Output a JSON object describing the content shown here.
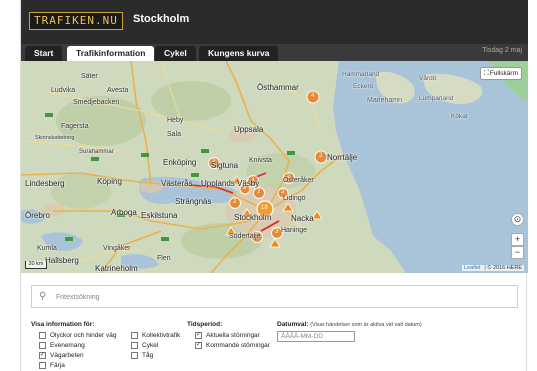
{
  "header": {
    "logo_text": "TRAFIKEN.NU",
    "city": "Stockholm"
  },
  "tabs": [
    {
      "label": "Start",
      "active": false
    },
    {
      "label": "Trafikinformation",
      "active": true
    },
    {
      "label": "Cykel",
      "active": false
    },
    {
      "label": "Kungens kurva",
      "active": false
    }
  ],
  "tab_date": "Tisdag 2 maj",
  "map": {
    "fullscreen_label": "Fullskärm",
    "zoom_in": "+",
    "zoom_out": "−",
    "locate_icon": "target-icon",
    "scale_label": "20 km",
    "attribution_leaflet": "Leaflet",
    "attribution_here": "| © 2016 HERE",
    "places": [
      "Säter",
      "Ludvika",
      "Avesta",
      "Smedjebacken",
      "Fagersta",
      "Skinnskatteberg",
      "Surahammar",
      "Heby",
      "Sala",
      "Uppsala",
      "Östhammar",
      "Hammarland",
      "Eckerö",
      "Mariehamn",
      "Lumparland",
      "Kökar",
      "Vårdö",
      "Enköping",
      "Sigtuna",
      "Knivsta",
      "Norrtälje",
      "Lindesberg",
      "Köping",
      "Västerås",
      "Upplands Väsby",
      "Österåker",
      "Strängnäs",
      "Lidingö",
      "Stockholm",
      "Nacka",
      "Örebro",
      "Arboga",
      "Eskilstuna",
      "Södertälje",
      "Haninge",
      "Kumla",
      "Hallsberg",
      "Vingåker",
      "Flen",
      "Katrineholm"
    ],
    "cluster_counts": [
      "4",
      "2",
      "2",
      "3",
      "2",
      "2",
      "18",
      "2",
      "3",
      "5",
      "3",
      "2"
    ]
  },
  "search": {
    "placeholder": "Fritextsökning",
    "icon": "search-icon"
  },
  "filters": {
    "show_info_title": "Visa information för:",
    "categories": [
      {
        "label": "Olyckor och hinder väg",
        "checked": false
      },
      {
        "label": "Evenemang",
        "checked": false
      },
      {
        "label": "Vägarbeten",
        "checked": true
      },
      {
        "label": "Färja",
        "checked": false
      },
      {
        "label": "Kollektivtrafik",
        "checked": false
      },
      {
        "label": "Cykel",
        "checked": false
      },
      {
        "label": "Tåg",
        "checked": false
      }
    ],
    "period_title": "Tidsperiod:",
    "periods": [
      {
        "label": "Aktuella störningar",
        "checked": true
      },
      {
        "label": "Kommande störningar",
        "checked": true
      }
    ],
    "date_title": "Datumval:",
    "date_hint": "(Visar händelser som är aktiva vid valt datum)",
    "date_placeholder": "ÅÅÅÅ-MM-DD"
  },
  "colors": {
    "header_bg": "#2b2b2b",
    "logo_accent": "#f0c44d",
    "cluster_orange": "#e8822a",
    "warning_orange": "#f08a1c",
    "sea": "#a9c4d8"
  }
}
